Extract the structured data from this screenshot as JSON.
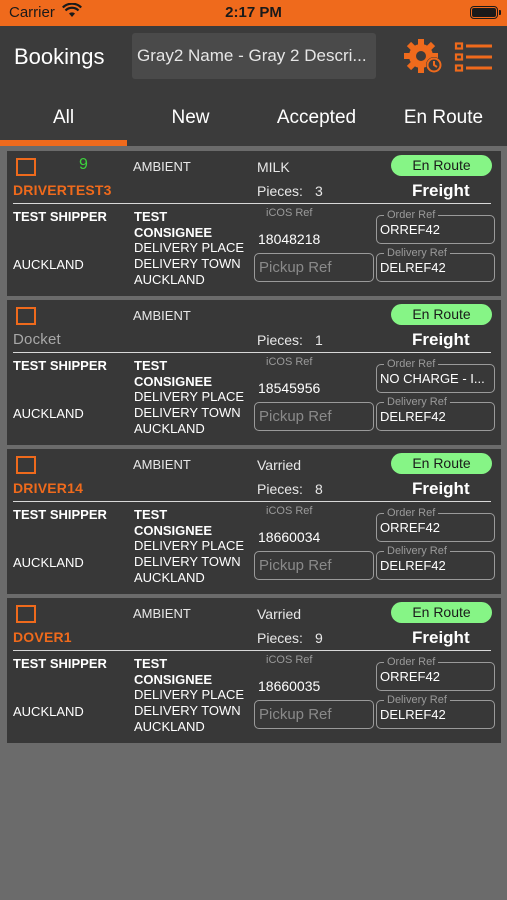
{
  "status_bar": {
    "carrier": "Carrier",
    "time": "2:17 PM"
  },
  "nav": {
    "title": "Bookings",
    "account_select": "Gray2 Name - Gray 2 Descri...",
    "settings_icon": "gear-icon",
    "list_icon": "list-icon"
  },
  "tabs": [
    {
      "label": "All",
      "active": true
    },
    {
      "label": "New"
    },
    {
      "label": "Accepted"
    },
    {
      "label": "En Route"
    }
  ],
  "bookings": [
    {
      "count": "9",
      "driver": "DRIVERTEST3",
      "temperature": "AMBIENT",
      "commodity": "MILK",
      "pieces_label": "Pieces:",
      "pieces": "3",
      "status": "En Route",
      "type": "Freight",
      "shipper": "TEST SHIPPER",
      "shipper_city": "AUCKLAND",
      "consignee_line1": "TEST",
      "consignee_line2": "CONSIGNEE",
      "delivery_place": "DELIVERY PLACE",
      "delivery_town": "DELIVERY TOWN",
      "consignee_city": "AUCKLAND",
      "icos_label": "iCOS Ref",
      "icos_ref": "18048218",
      "pickup_placeholder": "Pickup Ref",
      "order_label": "Order Ref",
      "order_ref": "ORREF42",
      "delivery_label": "Delivery Ref",
      "delivery_ref": "DELREF42"
    },
    {
      "count": "",
      "driver": "Docket",
      "temperature": "AMBIENT",
      "commodity": "",
      "pieces_label": "Pieces:",
      "pieces": "1",
      "status": "En Route",
      "type": "Freight",
      "shipper": "TEST SHIPPER",
      "shipper_city": "AUCKLAND",
      "consignee_line1": "TEST",
      "consignee_line2": "CONSIGNEE",
      "delivery_place": "DELIVERY PLACE",
      "delivery_town": "DELIVERY TOWN",
      "consignee_city": "AUCKLAND",
      "icos_label": "iCOS Ref",
      "icos_ref": "18545956",
      "pickup_placeholder": "Pickup Ref",
      "order_label": "Order Ref",
      "order_ref": "NO CHARGE - I...",
      "delivery_label": "Delivery Ref",
      "delivery_ref": "DELREF42"
    },
    {
      "count": "",
      "driver": "DRIVER14",
      "temperature": "AMBIENT",
      "commodity": "Varried",
      "pieces_label": "Pieces:",
      "pieces": "8",
      "status": "En Route",
      "type": "Freight",
      "shipper": "TEST SHIPPER",
      "shipper_city": "AUCKLAND",
      "consignee_line1": "TEST",
      "consignee_line2": "CONSIGNEE",
      "delivery_place": "DELIVERY PLACE",
      "delivery_town": "DELIVERY TOWN",
      "consignee_city": "AUCKLAND",
      "icos_label": "iCOS Ref",
      "icos_ref": "18660034",
      "pickup_placeholder": "Pickup Ref",
      "order_label": "Order Ref",
      "order_ref": "ORREF42",
      "delivery_label": "Delivery Ref",
      "delivery_ref": "DELREF42"
    },
    {
      "count": "",
      "driver": "DOVER1",
      "temperature": "AMBIENT",
      "commodity": "Varried",
      "pieces_label": "Pieces:",
      "pieces": "9",
      "status": "En Route",
      "type": "Freight",
      "shipper": "TEST SHIPPER",
      "shipper_city": "AUCKLAND",
      "consignee_line1": "TEST",
      "consignee_line2": "CONSIGNEE",
      "delivery_place": "DELIVERY PLACE",
      "delivery_town": "DELIVERY TOWN",
      "consignee_city": "AUCKLAND",
      "icos_label": "iCOS Ref",
      "icos_ref": "18660035",
      "pickup_placeholder": "Pickup Ref",
      "order_label": "Order Ref",
      "order_ref": "ORREF42",
      "delivery_label": "Delivery Ref",
      "delivery_ref": "DELREF42"
    }
  ],
  "colors": {
    "accent": "#ef6a1c",
    "status_pill": "#86f586",
    "count": "#3cd23c",
    "card_bg": "#383838",
    "page_bg": "#6b6b6b"
  }
}
